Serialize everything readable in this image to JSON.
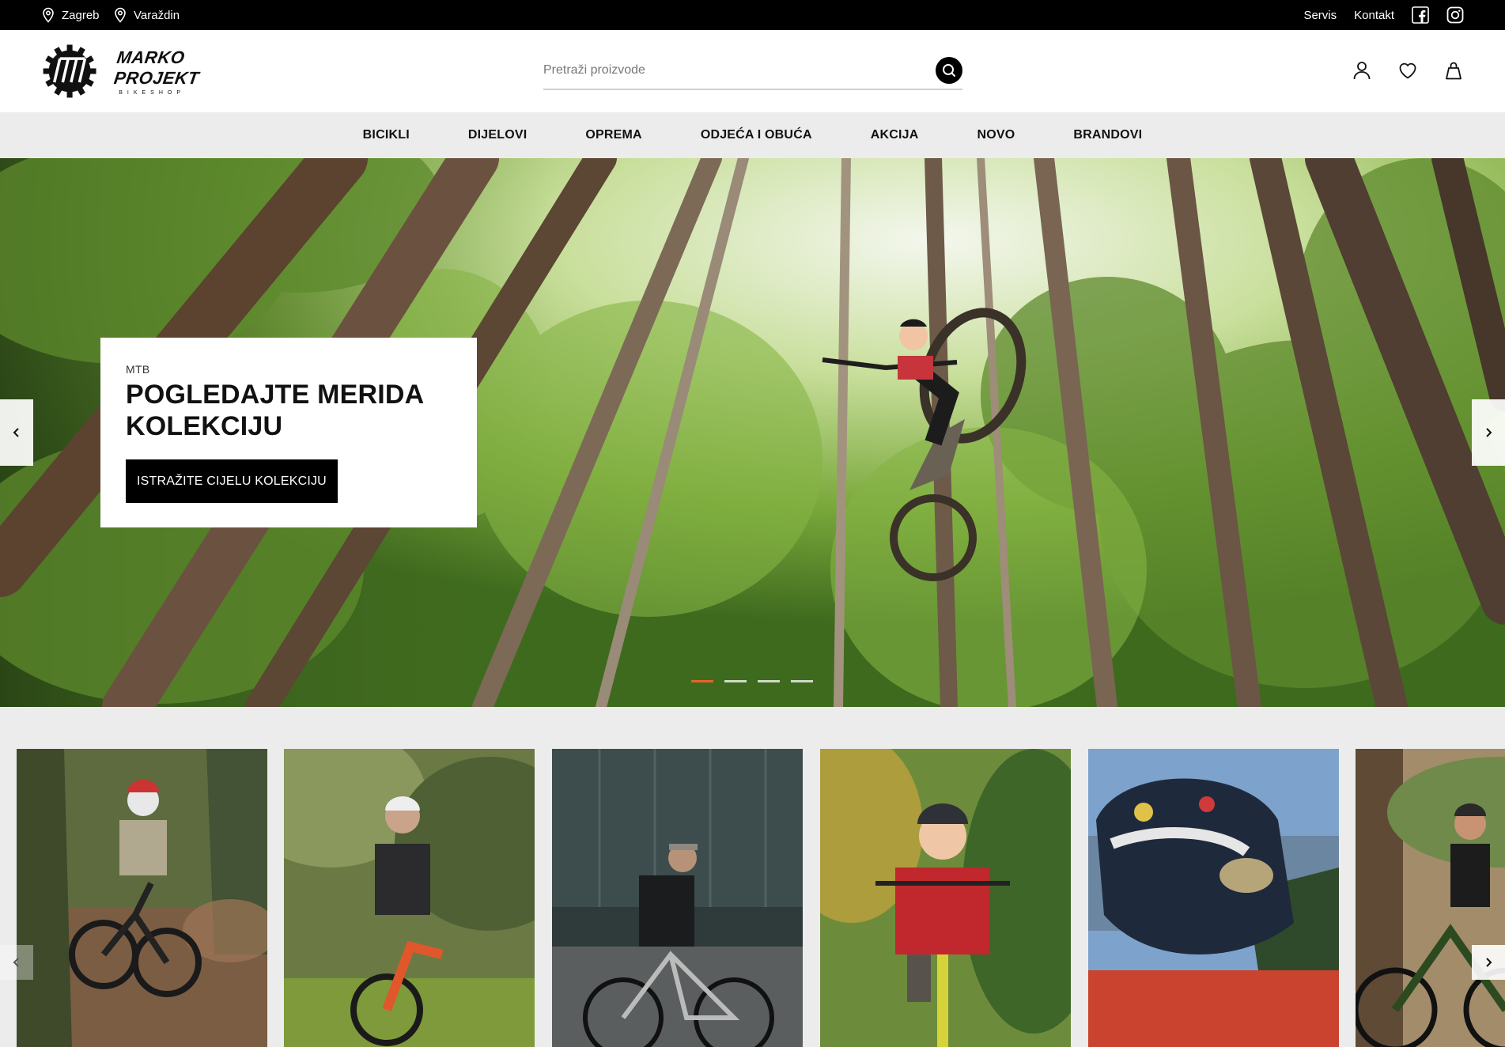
{
  "topbar": {
    "locations": [
      {
        "label": "Zagreb",
        "icon": "map-pin-icon"
      },
      {
        "label": "Varaždin",
        "icon": "map-pin-icon"
      }
    ],
    "links": [
      {
        "label": "Servis"
      },
      {
        "label": "Kontakt"
      }
    ],
    "social": [
      "facebook-icon",
      "instagram-icon"
    ]
  },
  "header": {
    "logo_text": "MARKO PROJEKT",
    "logo_sub": "BIKESHOP",
    "search_placeholder": "Pretraži proizvode",
    "icons": [
      "user-icon",
      "heart-icon",
      "bag-icon"
    ]
  },
  "nav": {
    "items": [
      "BICIKLI",
      "DIJELOVI",
      "OPREMA",
      "ODJEĆA I OBUĆA",
      "AKCIJA",
      "NOVO",
      "BRANDOVI"
    ]
  },
  "hero": {
    "eyebrow": "MTB",
    "title_line1": "POGLEDAJTE MERIDA",
    "title_line2": "KOLEKCIJU",
    "cta": "ISTRAŽITE CIJELU KOLEKCIJU",
    "slides_total": 4,
    "active_slide": 1,
    "colors": {
      "accent": "#e8622a",
      "forest": "#5d8a2c"
    }
  },
  "categories": {
    "tiles": [
      {
        "name": "mtb-rider-tile"
      },
      {
        "name": "gravel-rider-tile"
      },
      {
        "name": "city-rider-tile"
      },
      {
        "name": "kid-rider-tile"
      },
      {
        "name": "helmet-rider-tile"
      },
      {
        "name": "ebike-rider-tile"
      }
    ]
  }
}
